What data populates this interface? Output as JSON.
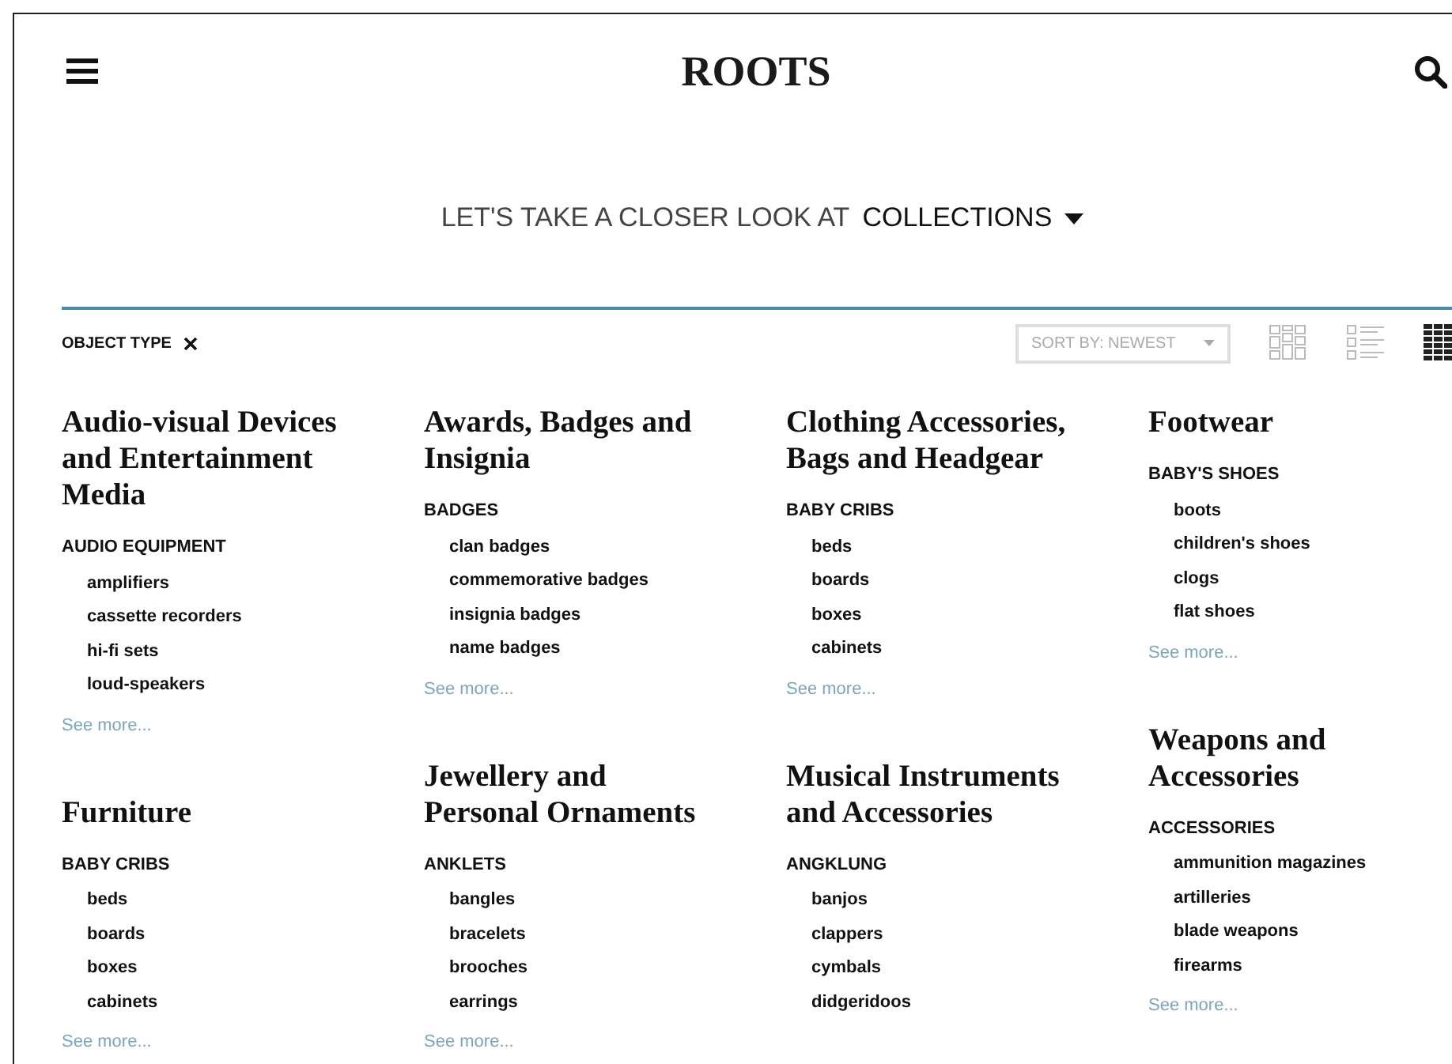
{
  "header": {
    "logo": "ROOTS"
  },
  "heading": {
    "prefix": "LET'S TAKE A CLOSER LOOK AT",
    "selector": "COLLECTIONS"
  },
  "filters": [
    {
      "label": "OBJECT TYPE"
    }
  ],
  "sort": {
    "label": "SORT BY: NEWEST"
  },
  "view_modes": [
    {
      "kind": "masonry",
      "selected": false
    },
    {
      "kind": "list",
      "selected": false
    },
    {
      "kind": "dense",
      "selected": true
    }
  ],
  "columns": [
    {
      "cards": [
        {
          "title": "Audio-visual Devices and Entertainment Media",
          "subcategory": "AUDIO EQUIPMENT",
          "items": [
            "amplifiers",
            "cassette recorders",
            "hi-fi sets",
            "loud-speakers"
          ],
          "see_more": "See more..."
        },
        {
          "title": "Furniture",
          "subcategory": "BABY CRIBS",
          "items": [
            "beds",
            "boards",
            "boxes",
            "cabinets"
          ],
          "see_more": "See more..."
        }
      ]
    },
    {
      "cards": [
        {
          "title": "Awards, Badges and Insignia",
          "subcategory": "BADGES",
          "items": [
            "clan badges",
            "commemorative badges",
            "insignia badges",
            "name badges"
          ],
          "see_more": "See more..."
        },
        {
          "title": "Jewellery and Personal Ornaments",
          "subcategory": "ANKLETS",
          "items": [
            "bangles",
            "bracelets",
            "brooches",
            "earrings"
          ],
          "see_more": "See more..."
        }
      ]
    },
    {
      "cards": [
        {
          "title": "Clothing Accessories, Bags and Headgear",
          "subcategory": "BABY CRIBS",
          "items": [
            "beds",
            "boards",
            "boxes",
            "cabinets"
          ],
          "see_more": "See more..."
        },
        {
          "title": "Musical Instruments and Accessories",
          "subcategory": "ANGKLUNG",
          "items": [
            "banjos",
            "clappers",
            "cymbals",
            "didgeridoos"
          ]
        }
      ]
    },
    {
      "cards": [
        {
          "title": "Footwear",
          "subcategory": "BABY'S SHOES",
          "items": [
            "boots",
            "children's shoes",
            "clogs",
            "flat shoes"
          ],
          "see_more": "See more..."
        },
        {
          "title": "Weapons and Accessories",
          "subcategory": "ACCESSORIES",
          "items": [
            "ammunition magazines",
            "artilleries",
            "blade weapons",
            "firearms"
          ],
          "see_more": "See more..."
        }
      ]
    }
  ]
}
